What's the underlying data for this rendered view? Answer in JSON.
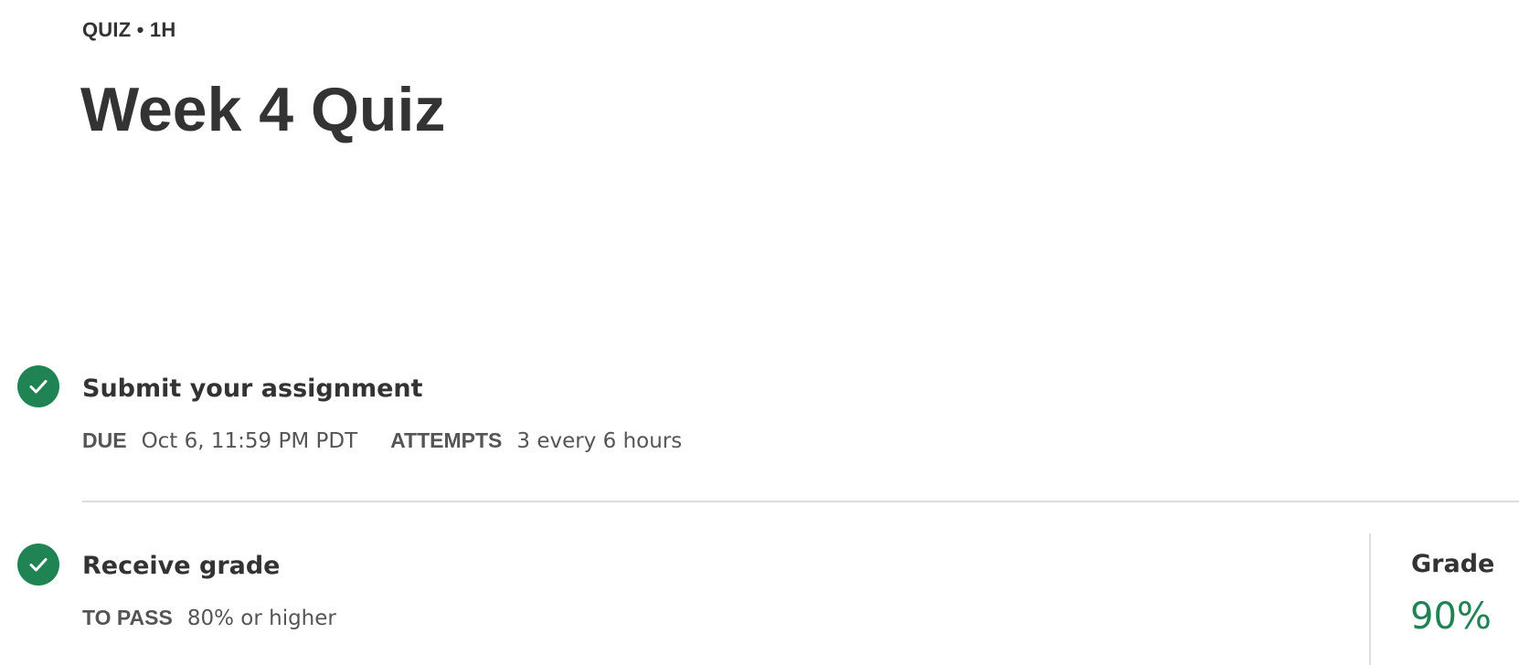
{
  "header": {
    "eyebrow": "QUIZ • 1H",
    "title": "Week 4 Quiz"
  },
  "steps": [
    {
      "title": "Submit your assignment",
      "icon": "check-circle-icon",
      "status": "complete",
      "meta": [
        {
          "key": "DUE",
          "value": "Oct 6, 11:59 PM PDT"
        },
        {
          "key": "ATTEMPTS",
          "value": "3 every 6 hours"
        }
      ]
    },
    {
      "title": "Receive grade",
      "icon": "check-circle-icon",
      "status": "complete",
      "meta": [
        {
          "key": "TO PASS",
          "value": "80% or higher"
        }
      ]
    }
  ],
  "grade": {
    "label": "Grade",
    "value": "90%"
  },
  "colors": {
    "success": "#1f8354",
    "text": "#333333",
    "muted": "#555555",
    "divider": "#dcdcdc"
  }
}
